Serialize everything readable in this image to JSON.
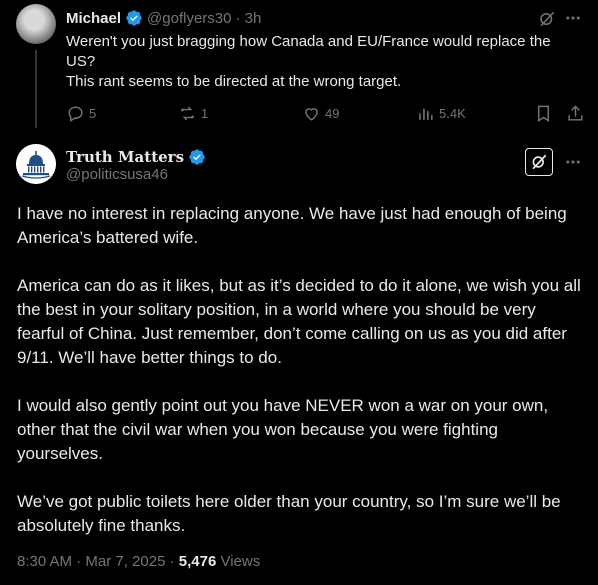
{
  "reply": {
    "author_name": "Michael",
    "handle": "@goflyers30",
    "time": "· 3h",
    "text_lines": [
      "Weren't you just bragging how Canada and EU/France would replace the",
      "US?",
      "This rant seems to be directed at the wrong target."
    ],
    "actions": {
      "replies": "5",
      "reposts": "1",
      "likes": "49",
      "views": "5.4K"
    }
  },
  "main_post": {
    "author_name": "Truth Matters",
    "handle": "@politicsusa46",
    "paragraphs": [
      "I have no interest in replacing anyone. We have just had enough of being America’s battered wife.",
      "America can do as it likes, but as it’s decided to do it alone, we wish you all the best in your solitary position, in a world where you should be very fearful of China. Just remember, don’t come calling on us as you did after 9/11. We’ll have better things to do.",
      "I would also gently point out you have NEVER won a war on your own, other that the civil war when you won because you were fighting yourselves.",
      "We’ve got public toilets here older than your country, so I’m sure we’ll be absolutely fine thanks."
    ],
    "timestamp": "8:30 AM · Mar 7, 2025 ·",
    "views_count": "5,476",
    "views_label": "Views"
  },
  "colors": {
    "background": "#000000",
    "text": "#e7e9ea",
    "muted": "#71767b",
    "verified": "#1d9bf0",
    "divider": "#333639"
  },
  "icons": [
    "grok-icon",
    "more-icon",
    "reply-icon",
    "repost-icon",
    "like-icon",
    "views-icon",
    "bookmark-icon",
    "share-icon",
    "verified-badge-icon"
  ]
}
